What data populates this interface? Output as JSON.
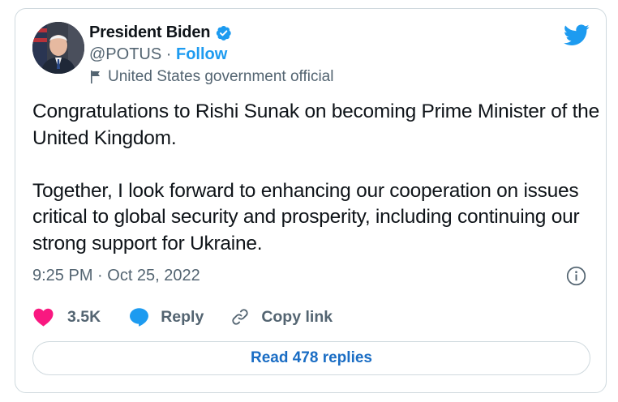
{
  "author": {
    "name": "President Biden",
    "handle": "@POTUS",
    "separator": "·",
    "follow_label": "Follow",
    "account_label": "United States government official"
  },
  "tweet": {
    "text": "Congratulations to Rishi Sunak on becoming Prime Minister of the United Kingdom.\n\nTogether, I look forward to enhancing our cooperation on issues critical to global security and prosperity, including continuing our strong support for Ukraine.",
    "timestamp": "9:25 PM · Oct 25, 2022"
  },
  "actions": {
    "like_count": "3.5K",
    "reply_label": "Reply",
    "copy_link_label": "Copy link"
  },
  "footer": {
    "read_replies_label": "Read 478 replies"
  },
  "icons": {
    "verified": "verified-badge-icon",
    "twitter": "twitter-bird-icon",
    "label": "flag-icon",
    "info": "info-icon",
    "like": "heart-icon",
    "reply": "speech-bubble-icon",
    "copy_link": "link-icon"
  },
  "colors": {
    "accent": "#1d9bf0",
    "like": "#f91880",
    "secondary_text": "#536471",
    "border": "#cfd9de",
    "replies_link": "#1a6dc4"
  }
}
